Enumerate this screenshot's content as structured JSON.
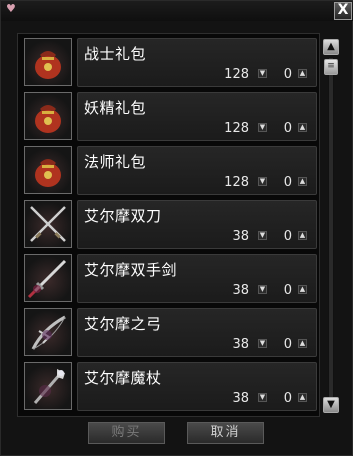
{
  "window": {
    "close_label": "X"
  },
  "items": [
    {
      "name": "战士礼包",
      "total": "128",
      "selected": "0",
      "icon": "pouch-icon"
    },
    {
      "name": "妖精礼包",
      "total": "128",
      "selected": "0",
      "icon": "pouch-icon"
    },
    {
      "name": "法师礼包",
      "total": "128",
      "selected": "0",
      "icon": "pouch-icon"
    },
    {
      "name": "艾尔摩双刀",
      "total": "38",
      "selected": "0",
      "icon": "dual-blade-icon"
    },
    {
      "name": "艾尔摩双手剑",
      "total": "38",
      "selected": "0",
      "icon": "two-hand-sword-icon"
    },
    {
      "name": "艾尔摩之弓",
      "total": "38",
      "selected": "0",
      "icon": "bow-icon"
    },
    {
      "name": "艾尔摩魔杖",
      "total": "38",
      "selected": "0",
      "icon": "staff-icon"
    }
  ],
  "buttons": {
    "buy": "购买",
    "cancel": "取消"
  }
}
